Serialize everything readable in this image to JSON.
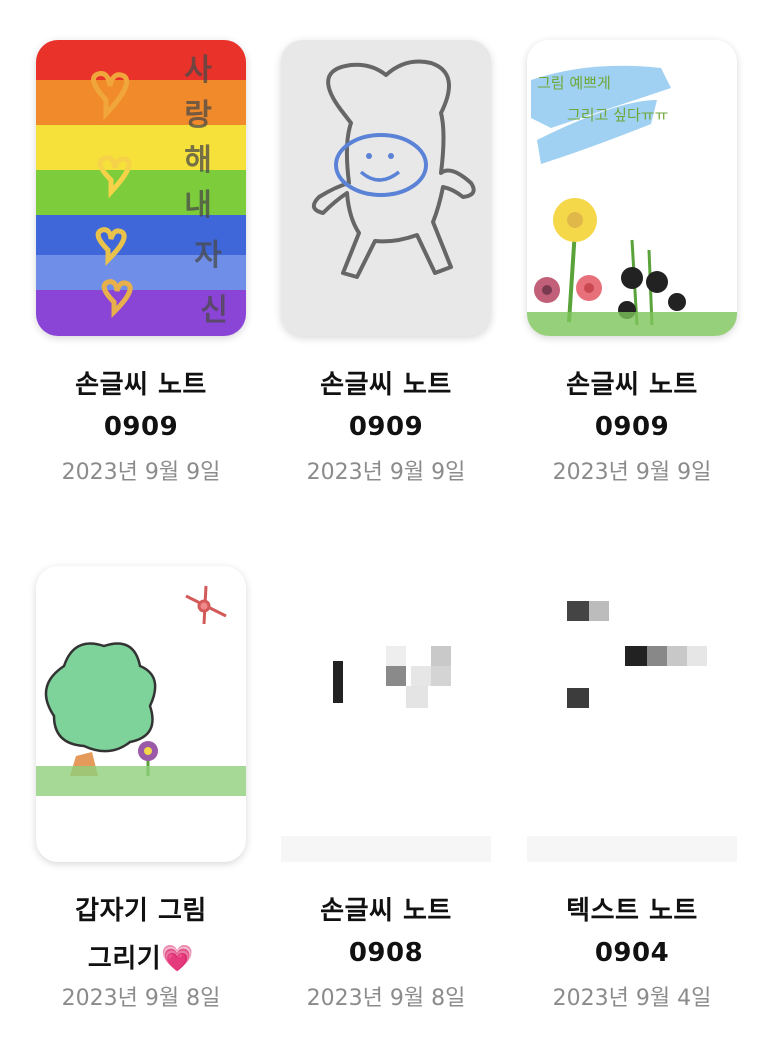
{
  "notes": [
    {
      "title": "손글씨 노트",
      "subtitle": "0909",
      "date": "2023년 9월 9일",
      "thumb": "rainbow",
      "thumb_text": "사랑해 내 자신"
    },
    {
      "title": "손글씨 노트",
      "subtitle": "0909",
      "date": "2023년 9월 9일",
      "thumb": "smiley-character"
    },
    {
      "title": "손글씨 노트",
      "subtitle": "0909",
      "date": "2023년 9월 9일",
      "thumb": "flowers",
      "thumb_text": "그림 예쁘게 그리고 싶다ㅠㅠ"
    },
    {
      "title": "갑자기 그림",
      "subtitle": "그리기",
      "subtitle_emoji": "💗",
      "date": "2023년 9월 8일",
      "thumb": "tree"
    },
    {
      "title": "손글씨 노트",
      "subtitle": "0908",
      "date": "2023년 9월 8일",
      "thumb": "pixelated"
    },
    {
      "title": "텍스트 노트",
      "subtitle": "0904",
      "date": "2023년 9월 4일",
      "thumb": "pixelated-text"
    }
  ],
  "colors": {
    "title": "#111111",
    "date": "#8b8b8b",
    "background": "#ffffff"
  }
}
